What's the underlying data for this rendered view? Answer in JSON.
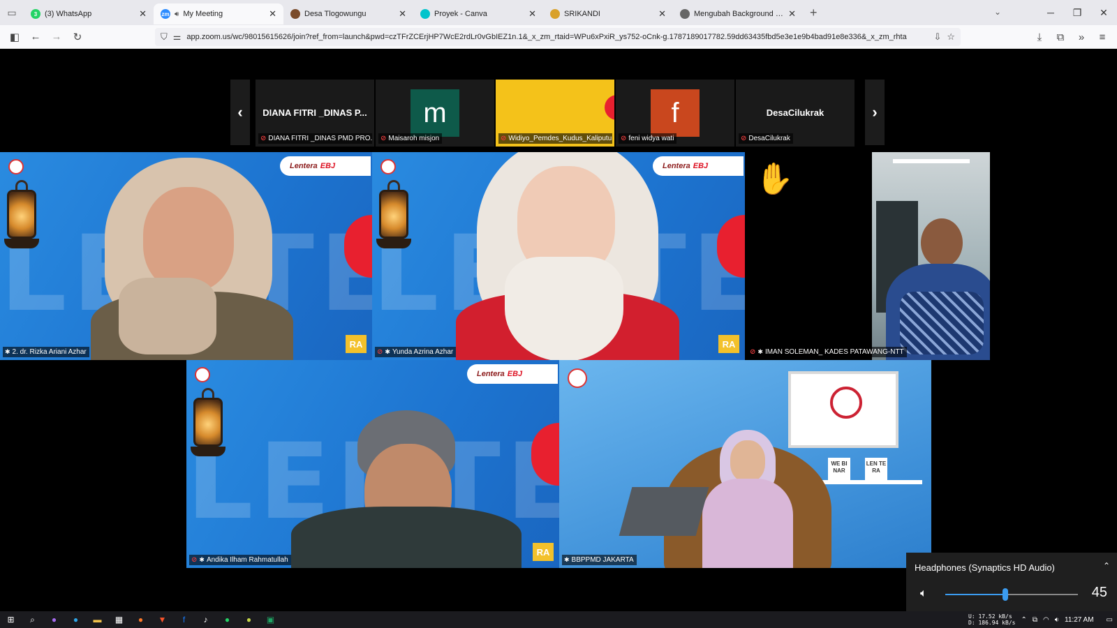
{
  "browser": {
    "tabs": [
      {
        "label": "(3) WhatsApp",
        "icon": "whatsapp-icon",
        "color": "#25d366",
        "badge": "3"
      },
      {
        "label": "My Meeting",
        "icon": "zoom-icon",
        "color": "#2d8cff",
        "badge": "zm",
        "active": true
      },
      {
        "label": "Desa Tlogowungu",
        "icon": "globe-icon",
        "color": "#7a4b2a",
        "badge": ""
      },
      {
        "label": "Proyek - Canva",
        "icon": "canva-icon",
        "color": "#00c4cc",
        "badge": ""
      },
      {
        "label": "SRIKANDI",
        "icon": "srikandi-icon",
        "color": "#d9a12a",
        "badge": ""
      },
      {
        "label": "Mengubah Background Zoom",
        "icon": "globe-icon",
        "color": "#666666",
        "badge": ""
      }
    ],
    "url": "app.zoom.us/wc/98015615626/join?ref_from=launch&pwd=czTFrZCErjHP7WcE2rdLr0vGbIEZ1n.1&_x_zm_rtaid=WPu6xPxiR_ys752-oCnk-g.1787189017782.59dd63435fbd5e3e1e9b4bad91e8e336&_x_zm_rhta"
  },
  "meeting": {
    "strip": [
      {
        "big": "DIANA FITRI _DINAS P...",
        "name": "DIANA FITRI _DINAS PMD PRO...",
        "type": "text"
      },
      {
        "big": "m",
        "name": "Maisaroh misjon",
        "type": "avatar",
        "color": "#0e5a4a"
      },
      {
        "big": "",
        "name": "Widiyo_Pemdes_Kudus_Kaliputu",
        "type": "video",
        "color": "#f4c21a"
      },
      {
        "big": "f",
        "name": "feni widya wati",
        "type": "avatar",
        "color": "#c9471e"
      },
      {
        "big": "DesaCilukrak",
        "name": "DesaCilukrak",
        "type": "text"
      }
    ],
    "tiles": {
      "rizka": "2. dr. Rizka Ariani Azhar",
      "yunda": "Yunda Azrina Azhar",
      "iman": "IMAN SOLEMAN_ KADES PATAWANG-NTT",
      "andika": "Andika Ilham Rahmatullah",
      "bbppmd": "BBPPMD JAKARTA"
    },
    "bg_text": "LENTERA",
    "logo_text": "Lentera",
    "logo_suffix": "EBJ",
    "ra_text": "RA",
    "studio_text_1": "WE BI NAR",
    "studio_text_2": "LEN TE RA"
  },
  "audio": {
    "device": "Headphones (Synaptics HD Audio)",
    "volume": "45",
    "volume_fraction": 0.45
  },
  "taskbar": {
    "net_up": "U:   17.52 kB/s",
    "net_down": "D:  186.94 kB/s",
    "time": "11:27 AM"
  }
}
